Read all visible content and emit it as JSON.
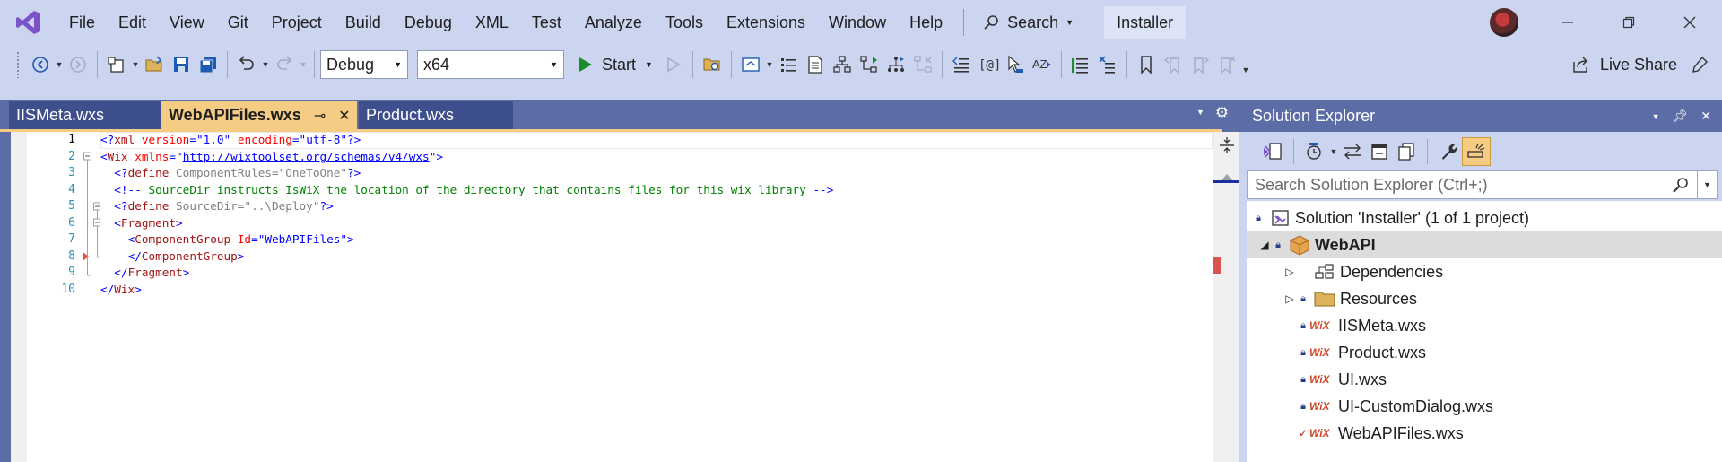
{
  "menu": [
    "File",
    "Edit",
    "View",
    "Git",
    "Project",
    "Build",
    "Debug",
    "XML",
    "Test",
    "Analyze",
    "Tools",
    "Extensions",
    "Window",
    "Help"
  ],
  "search": {
    "label": "Search"
  },
  "solution_badge": "Installer",
  "toolbar": {
    "config_value": "Debug",
    "platform_value": "x64",
    "start_label": "Start",
    "live_share_label": "Live Share"
  },
  "tabs": [
    {
      "label": "IISMeta.wxs",
      "active": false
    },
    {
      "label": "WebAPIFiles.wxs",
      "active": true
    },
    {
      "label": "Product.wxs",
      "active": false
    }
  ],
  "editor": {
    "line_numbers": [
      "1",
      "2",
      "3",
      "4",
      "5",
      "6",
      "7",
      "8",
      "9",
      "10"
    ]
  },
  "solution_explorer": {
    "title": "Solution Explorer",
    "search_placeholder": "Search Solution Explorer (Ctrl+;)",
    "solution_label": "Solution 'Installer' (1 of 1 project)",
    "project_label": "WebAPI",
    "items": [
      {
        "label": "Dependencies"
      },
      {
        "label": "Resources"
      },
      {
        "label": "IISMeta.wxs",
        "badge": "WiX"
      },
      {
        "label": "Product.wxs",
        "badge": "WiX"
      },
      {
        "label": "UI.wxs",
        "badge": "WiX"
      },
      {
        "label": "UI-CustomDialog.wxs",
        "badge": "WiX"
      },
      {
        "label": "WebAPIFiles.wxs",
        "badge": "WiX"
      }
    ]
  },
  "colors": {
    "chrome_bg": "#ccd5f0",
    "well_bg": "#5b6ca6",
    "active_tab": "#f5cc84",
    "inactive_tab": "#3d4f8c",
    "vs_purple": "#7b52c7"
  }
}
